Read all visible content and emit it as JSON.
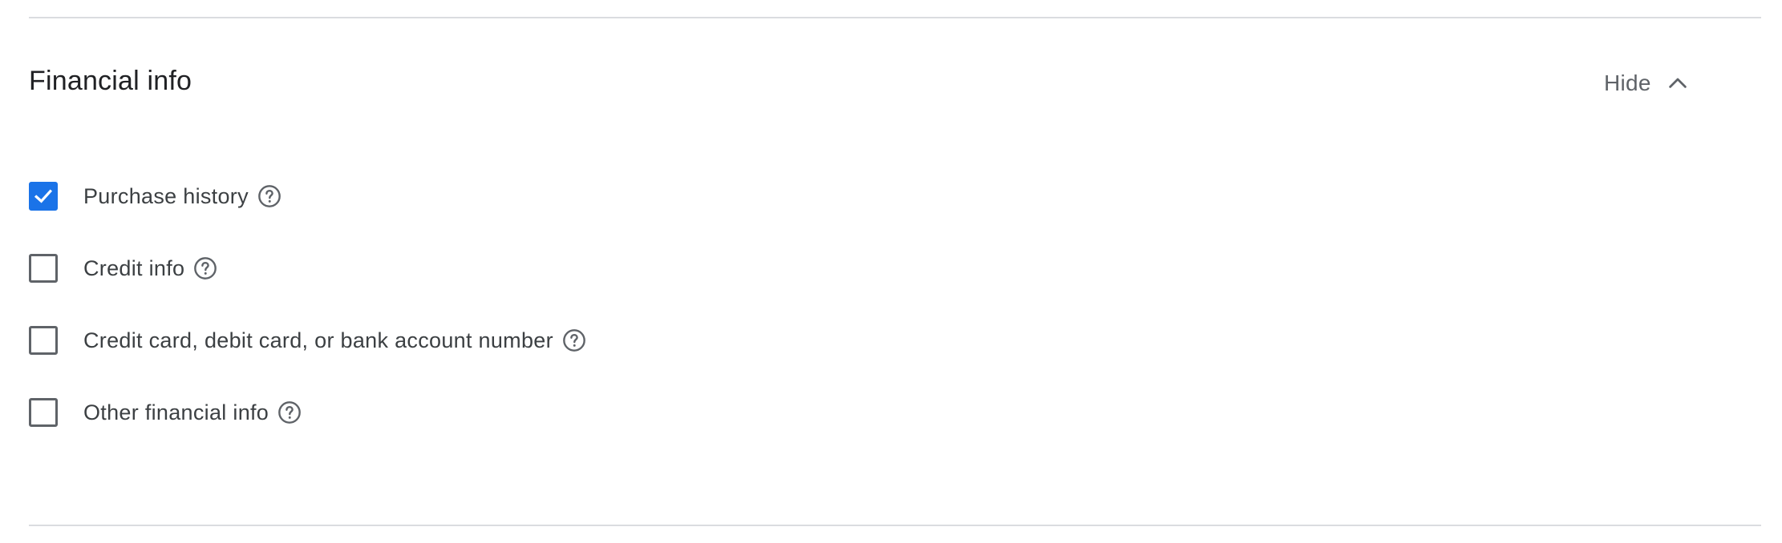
{
  "section": {
    "title": "Financial info",
    "toggle_label": "Hide",
    "toggle_icon": "chevron-up-icon"
  },
  "options": [
    {
      "label": "Purchase history",
      "checked": true
    },
    {
      "label": "Credit info",
      "checked": false
    },
    {
      "label": "Credit card, debit card, or bank account number",
      "checked": false
    },
    {
      "label": "Other financial info",
      "checked": false
    }
  ],
  "colors": {
    "accent": "#1a73e8",
    "checkbox_border": "#5f6368",
    "divider": "#dadce0",
    "text": "#202124",
    "muted": "#5f6368"
  }
}
